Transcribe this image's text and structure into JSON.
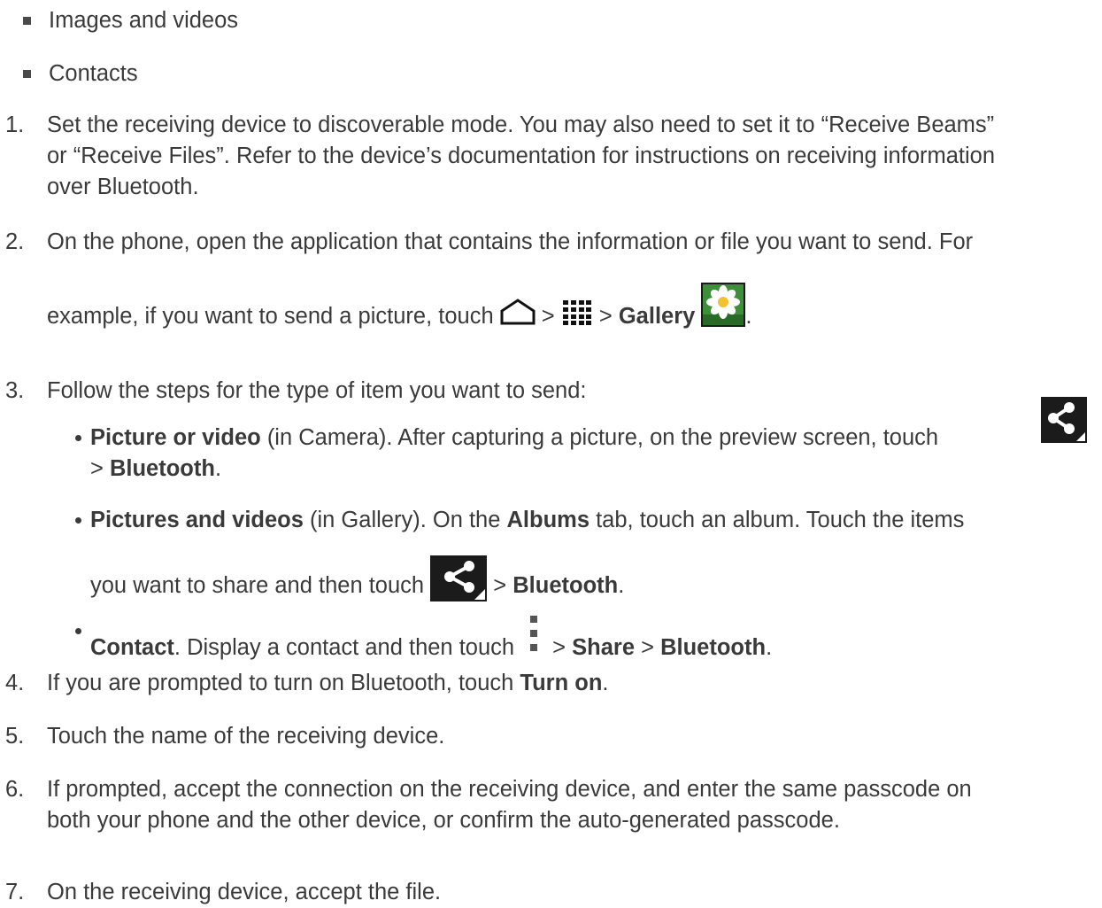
{
  "bullets": [
    "Images and videos",
    "Contacts"
  ],
  "steps": {
    "s1": {
      "num": "1.",
      "line1": "Set the receiving device to discoverable mode. You may also need to set it to “Receive Beams”",
      "line2": "or “Receive Files”. Refer to the device’s documentation for instructions on receiving information",
      "line3": "over Bluetooth."
    },
    "s2": {
      "num": "2.",
      "line1": "On the phone, open the application that contains the information or file you want to send. For",
      "line2a": "example, if you want to send a picture, touch ",
      "sep1": " > ",
      "sep2": " > ",
      "gallery": "Gallery",
      "end": "."
    },
    "s3": {
      "num": "3.",
      "text": "Follow the steps for the type of item you want to send:"
    },
    "s4": {
      "num": "4.",
      "text": "If you are prompted to turn on Bluetooth, touch ",
      "bold": "Turn on",
      "end": "."
    },
    "s5": {
      "num": "5.",
      "text": "Touch the name of the receiving device."
    },
    "s6": {
      "num": "6.",
      "line1": "If prompted, accept the connection on the receiving device, and enter the same passcode on",
      "line2": "both your phone and the other device, or confirm the auto-generated passcode."
    },
    "s7": {
      "num": "7.",
      "text": "On the receiving device, accept the file."
    }
  },
  "sub_items": {
    "picture": {
      "bold": "Picture or video",
      "text": " (in Camera). After capturing a picture, on the preview screen, touch",
      "sep": "> ",
      "bluetooth": "Bluetooth",
      "end": "."
    },
    "pictures": {
      "bold": "Pictures and videos",
      "text1": " (in Gallery). On the ",
      "albums": "Albums",
      "text2": " tab, touch an album. Touch the items",
      "line2": "you want to share and then touch ",
      "sep": " > ",
      "bluetooth": "Bluetooth",
      "end": "."
    },
    "contact": {
      "bold": "Contact",
      "text": ". Display a contact and then touch ",
      "sep1": "> ",
      "share": "Share",
      "sep2": " > ",
      "bluetooth": "Bluetooth",
      "end": "."
    }
  },
  "icons": [
    "home-icon",
    "apps-grid-icon",
    "gallery-icon",
    "share-icon",
    "overflow-menu-icon"
  ],
  "colors": {
    "text": "#3a3a3a",
    "icon_bg": "#1b1b1b",
    "gallery_green": "#3e8f3a"
  }
}
